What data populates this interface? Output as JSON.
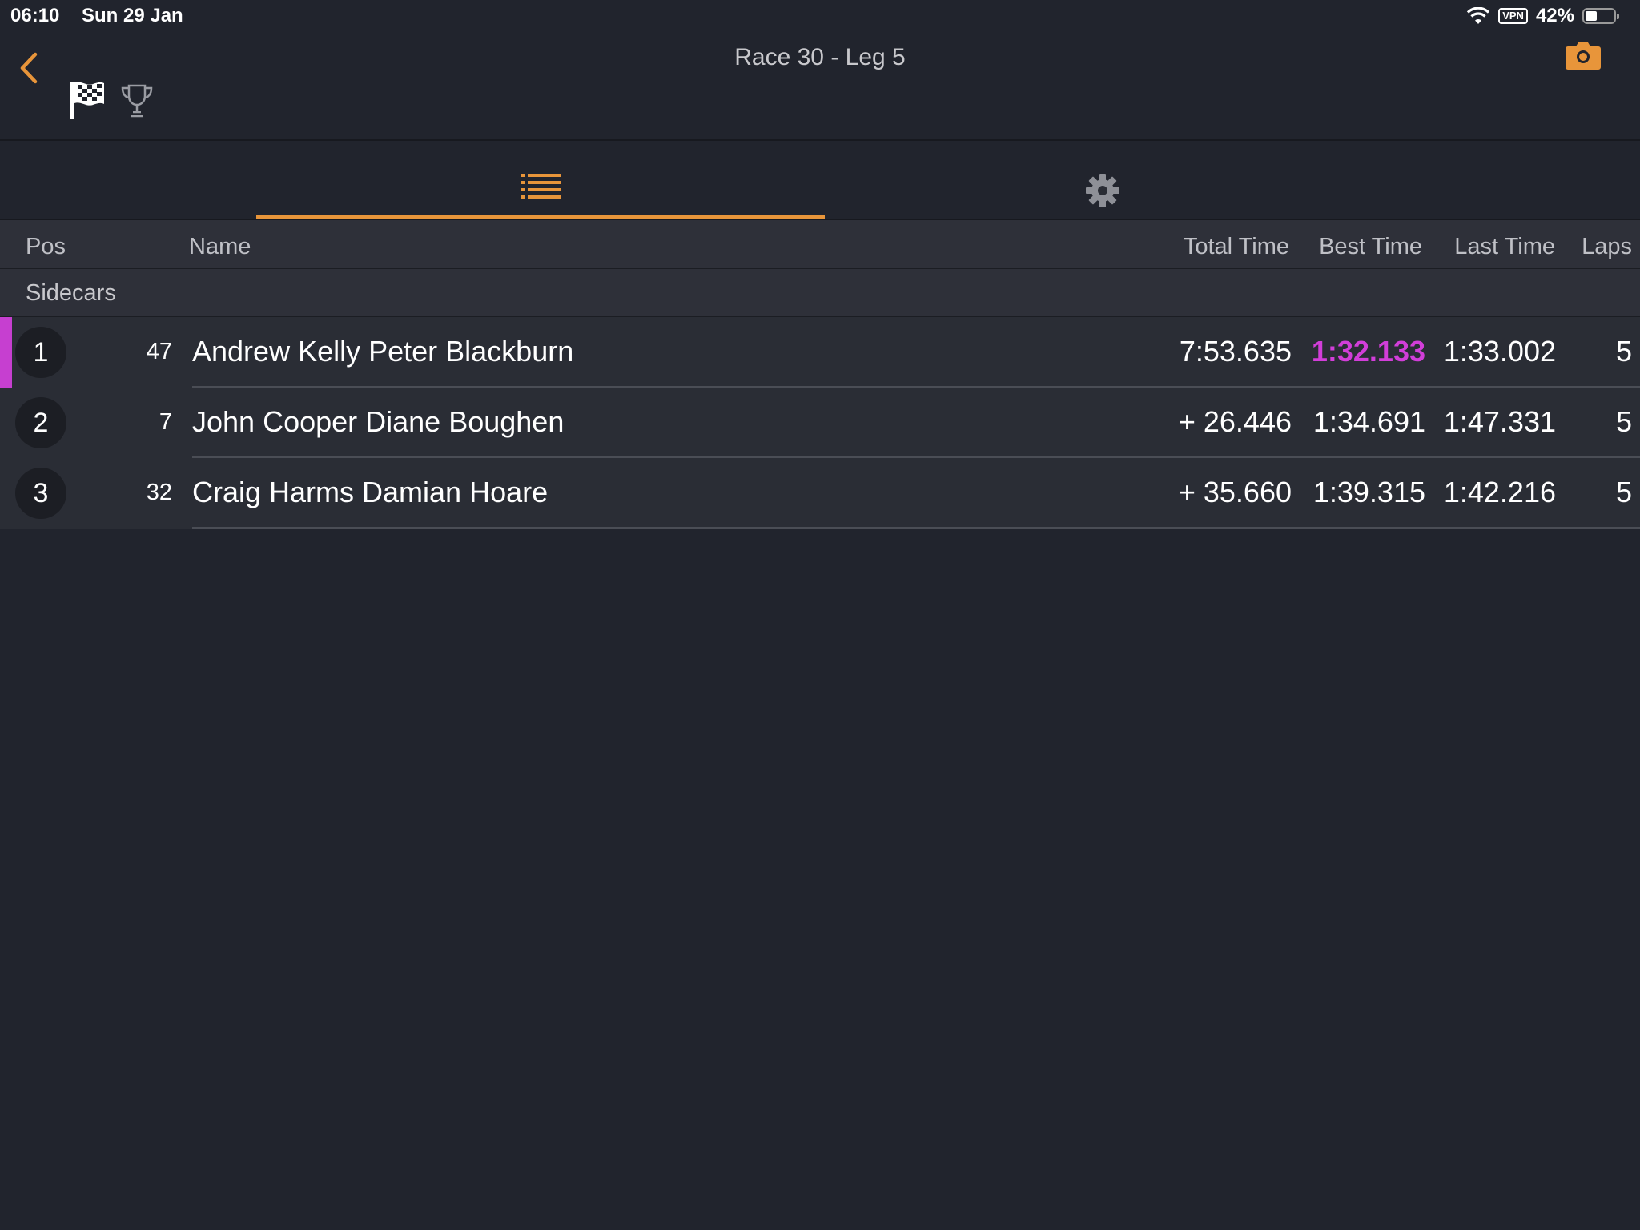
{
  "status_bar": {
    "time": "06:10",
    "date": "Sun 29 Jan",
    "vpn": "VPN",
    "battery": "42%",
    "battery_level": 0.42
  },
  "nav": {
    "title": "Race 30 - Leg 5",
    "icons": [
      "back-chevron-icon",
      "checkered-flag-icon",
      "trophy-icon",
      "camera-icon"
    ]
  },
  "tabs": [
    {
      "icon": "list-icon",
      "active": true
    },
    {
      "icon": "gear-icon",
      "active": false
    }
  ],
  "table": {
    "headers": {
      "pos": "Pos",
      "name": "Name",
      "total": "Total Time",
      "best": "Best Time",
      "last": "Last Time",
      "laps": "Laps"
    },
    "group": "Sidecars",
    "rows": [
      {
        "pos": "1",
        "number": "47",
        "name": "Andrew Kelly Peter Blackburn",
        "total": "7:53.635",
        "best": "1:32.133",
        "last": "1:33.002",
        "laps": "5"
      },
      {
        "pos": "2",
        "number": "7",
        "name": "John Cooper Diane Boughen",
        "total": "+ 26.446",
        "best": "1:34.691",
        "last": "1:47.331",
        "laps": "5"
      },
      {
        "pos": "3",
        "number": "32",
        "name": "Craig Harms Damian Hoare",
        "total": "+ 35.660",
        "best": "1:39.315",
        "last": "1:42.216",
        "laps": "5"
      }
    ]
  },
  "colors": {
    "accent": "#e8953a",
    "fastest_lap": "#d23ed9",
    "background": "#21242d"
  }
}
